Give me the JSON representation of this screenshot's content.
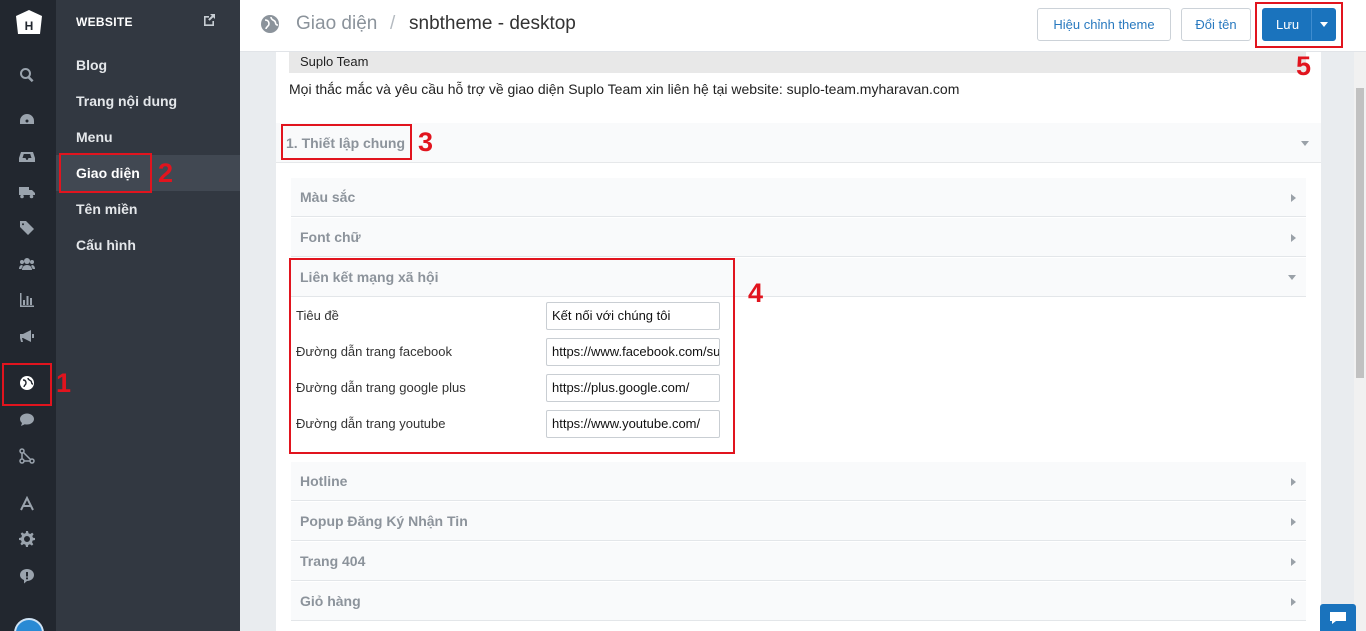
{
  "sidebar": {
    "section_title": "WEBSITE",
    "items": [
      {
        "label": "Blog"
      },
      {
        "label": "Trang nội dung"
      },
      {
        "label": "Menu"
      },
      {
        "label": "Giao diện"
      },
      {
        "label": "Tên miền"
      },
      {
        "label": "Cấu hình"
      }
    ],
    "active_item": "Giao diện"
  },
  "rail": {
    "icons": [
      "logo-icon",
      "search-icon",
      "dashboard-icon",
      "inbox-icon",
      "truck-icon",
      "tag-icon",
      "users-icon",
      "chart-icon",
      "megaphone-icon",
      "globe-icon",
      "chat-icon",
      "apps-icon",
      "shipping-icon",
      "gear-icon",
      "help-icon",
      "avatar"
    ],
    "active_icon": "globe-icon"
  },
  "header": {
    "breadcrumb": "Giao diện",
    "separator": "/",
    "title": "snbtheme - desktop",
    "buttons": {
      "edit_theme": "Hiệu chỉnh theme",
      "rename": "Đổi tên",
      "save": "Lưu"
    }
  },
  "content": {
    "banner": "Suplo Team",
    "note": "Mọi thắc mắc và yêu cầu hỗ trợ về giao diện Suplo Team xin liên hệ tại website: suplo-team.myharavan.com",
    "section_title": "1. Thiết lập chung",
    "accordions": [
      {
        "label": "Màu sắc"
      },
      {
        "label": "Font chữ"
      },
      {
        "label": "Liên kết mạng xã hội"
      },
      {
        "label": "Hotline"
      },
      {
        "label": "Popup Đăng Ký Nhận Tin"
      },
      {
        "label": "Trang 404"
      },
      {
        "label": "Giỏ hàng"
      }
    ],
    "social_fields": [
      {
        "label": "Tiêu đề",
        "value": "Kết nối với chúng tôi"
      },
      {
        "label": "Đường dẫn trang facebook",
        "value": "https://www.facebook.com/suplo"
      },
      {
        "label": "Đường dẫn trang google plus",
        "value": "https://plus.google.com/"
      },
      {
        "label": "Đường dẫn trang youtube",
        "value": "https://www.youtube.com/"
      }
    ]
  },
  "annotations": [
    "1",
    "2",
    "3",
    "4",
    "5"
  ],
  "colors": {
    "primary": "#1a73bd",
    "annotation": "#e1141e",
    "rail_bg": "#22272f",
    "submenu_bg": "#323841"
  }
}
